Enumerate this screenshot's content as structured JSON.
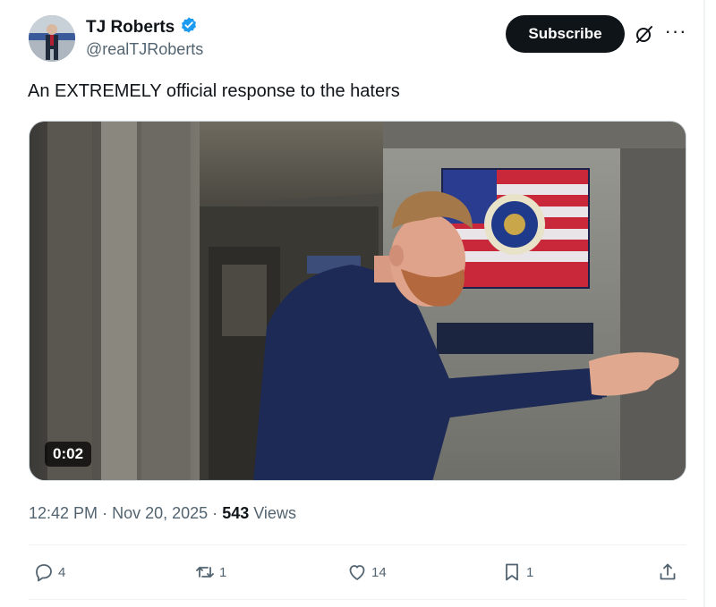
{
  "author": {
    "name": "TJ Roberts",
    "handle": "@realTJRoberts",
    "verified_badge_color": "#1d9bf0"
  },
  "header": {
    "subscribe_label": "Subscribe",
    "grok_icon": "grok-icon",
    "more_icon": "more-icon"
  },
  "tweet": {
    "text": "An EXTREMELY official response to the haters"
  },
  "video": {
    "duration": "0:02"
  },
  "meta": {
    "time": "12:42 PM",
    "separator1": "·",
    "date": "Nov 20, 2025",
    "separator2": "·",
    "views_count": "543",
    "views_label": "Views"
  },
  "actions": {
    "replies": "4",
    "reposts": "1",
    "likes": "14",
    "bookmarks": "1"
  },
  "colors": {
    "text_primary": "#0f1419",
    "text_secondary": "#536471",
    "border": "#eff3f4"
  }
}
